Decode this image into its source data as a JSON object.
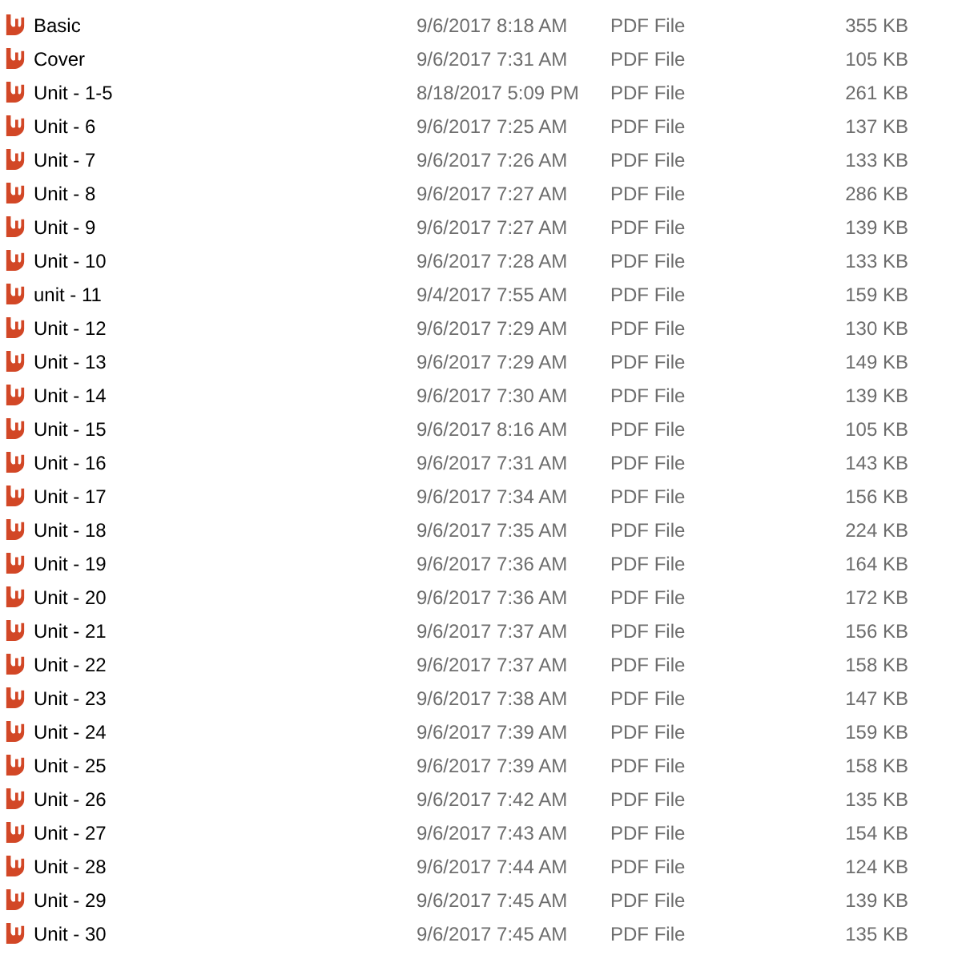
{
  "files": [
    {
      "name": "Basic",
      "date": "9/6/2017 8:18 AM",
      "type": "PDF File",
      "size": "355 KB"
    },
    {
      "name": "Cover",
      "date": "9/6/2017 7:31 AM",
      "type": "PDF File",
      "size": "105 KB"
    },
    {
      "name": "Unit - 1-5",
      "date": "8/18/2017 5:09 PM",
      "type": "PDF File",
      "size": "261 KB"
    },
    {
      "name": "Unit - 6",
      "date": "9/6/2017 7:25 AM",
      "type": "PDF File",
      "size": "137 KB"
    },
    {
      "name": "Unit - 7",
      "date": "9/6/2017 7:26 AM",
      "type": "PDF File",
      "size": "133 KB"
    },
    {
      "name": "Unit - 8",
      "date": "9/6/2017 7:27 AM",
      "type": "PDF File",
      "size": "286 KB"
    },
    {
      "name": "Unit - 9",
      "date": "9/6/2017 7:27 AM",
      "type": "PDF File",
      "size": "139 KB"
    },
    {
      "name": "Unit - 10",
      "date": "9/6/2017 7:28 AM",
      "type": "PDF File",
      "size": "133 KB"
    },
    {
      "name": "unit - 11",
      "date": "9/4/2017 7:55 AM",
      "type": "PDF File",
      "size": "159 KB"
    },
    {
      "name": "Unit - 12",
      "date": "9/6/2017 7:29 AM",
      "type": "PDF File",
      "size": "130 KB"
    },
    {
      "name": "Unit - 13",
      "date": "9/6/2017 7:29 AM",
      "type": "PDF File",
      "size": "149 KB"
    },
    {
      "name": "Unit - 14",
      "date": "9/6/2017 7:30 AM",
      "type": "PDF File",
      "size": "139 KB"
    },
    {
      "name": "Unit - 15",
      "date": "9/6/2017 8:16 AM",
      "type": "PDF File",
      "size": "105 KB"
    },
    {
      "name": "Unit - 16",
      "date": "9/6/2017 7:31 AM",
      "type": "PDF File",
      "size": "143 KB"
    },
    {
      "name": "Unit - 17",
      "date": "9/6/2017 7:34 AM",
      "type": "PDF File",
      "size": "156 KB"
    },
    {
      "name": "Unit - 18",
      "date": "9/6/2017 7:35 AM",
      "type": "PDF File",
      "size": "224 KB"
    },
    {
      "name": "Unit - 19",
      "date": "9/6/2017 7:36 AM",
      "type": "PDF File",
      "size": "164 KB"
    },
    {
      "name": "Unit - 20",
      "date": "9/6/2017 7:36 AM",
      "type": "PDF File",
      "size": "172 KB"
    },
    {
      "name": "Unit - 21",
      "date": "9/6/2017 7:37 AM",
      "type": "PDF File",
      "size": "156 KB"
    },
    {
      "name": "Unit - 22",
      "date": "9/6/2017 7:37 AM",
      "type": "PDF File",
      "size": "158 KB"
    },
    {
      "name": "Unit - 23",
      "date": "9/6/2017 7:38 AM",
      "type": "PDF File",
      "size": "147 KB"
    },
    {
      "name": "Unit - 24",
      "date": "9/6/2017 7:39 AM",
      "type": "PDF File",
      "size": "159 KB"
    },
    {
      "name": "Unit - 25",
      "date": "9/6/2017 7:39 AM",
      "type": "PDF File",
      "size": "158 KB"
    },
    {
      "name": "Unit - 26",
      "date": "9/6/2017 7:42 AM",
      "type": "PDF File",
      "size": "135 KB"
    },
    {
      "name": "Unit - 27",
      "date": "9/6/2017 7:43 AM",
      "type": "PDF File",
      "size": "154 KB"
    },
    {
      "name": "Unit - 28",
      "date": "9/6/2017 7:44 AM",
      "type": "PDF File",
      "size": "124 KB"
    },
    {
      "name": "Unit - 29",
      "date": "9/6/2017 7:45 AM",
      "type": "PDF File",
      "size": "139 KB"
    },
    {
      "name": "Unit - 30",
      "date": "9/6/2017 7:45 AM",
      "type": "PDF File",
      "size": "135 KB"
    }
  ]
}
